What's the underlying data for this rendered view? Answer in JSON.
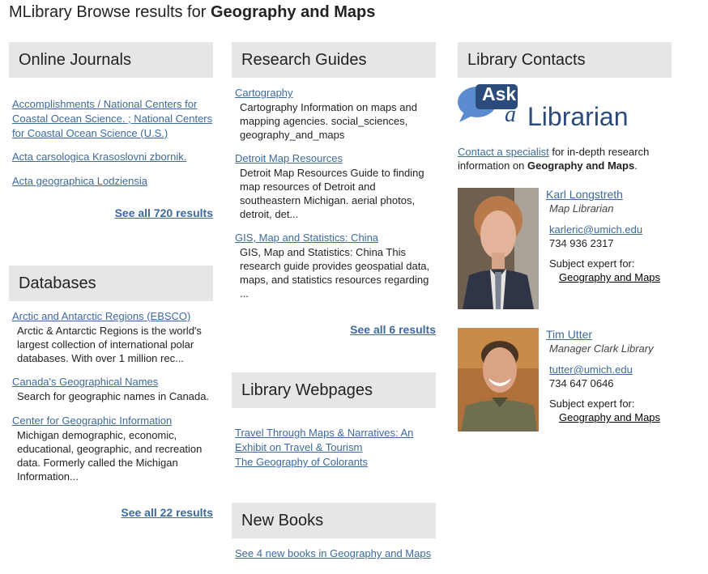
{
  "header": {
    "title_prefix": "MLibrary Browse results for",
    "title_subject": "Geography and Maps"
  },
  "journals": {
    "heading": "Online Journals",
    "items": [
      "Accomplishments / National Centers for Coastal Ocean Science. ; National Centers for Coastal Ocean Science (U.S.)",
      "Acta carsologica Krasoslovni zbornik.",
      "Acta geographica Lodziensia"
    ],
    "see_all": "See all 720 results"
  },
  "databases": {
    "heading": "Databases",
    "items": [
      {
        "title": "Arctic and Antarctic Regions (EBSCO)",
        "desc": "Arctic & Antarctic Regions is the world's largest collection of international polar databases. With over 1 million rec..."
      },
      {
        "title": "Canada's Geographical Names",
        "desc": "Search for geographic names in Canada."
      },
      {
        "title": "Center for Geographic Information",
        "desc": "Michigan demographic, economic, educational, geographic, and recreation data. Formerly called the Michigan Information..."
      }
    ],
    "see_all": "See all 22 results"
  },
  "guides": {
    "heading": "Research Guides",
    "items": [
      {
        "title": "Cartography",
        "desc": "Cartography Information on maps and mapping agencies. social_sciences, geography_and_maps"
      },
      {
        "title": "Detroit Map Resources",
        "desc": "Detroit Map Resources Guide to finding map resources of Detroit and southeastern Michigan. aerial photos, detroit, det..."
      },
      {
        "title": "GIS, Map and Statistics: China",
        "desc": "GIS, Map and Statistics: China This research guide provides geospatial data, maps, and statistics resources regarding ..."
      }
    ],
    "see_all": "See all 6 results"
  },
  "webpages": {
    "heading": "Library Webpages",
    "items": [
      "Travel Through Maps & Narratives: An Exhibit on Travel & Tourism",
      "The Geography of Colorants"
    ]
  },
  "books": {
    "heading": "New Books",
    "link": "See 4 new books in Geography and Maps"
  },
  "contacts": {
    "heading": "Library Contacts",
    "logo": {
      "ask": "Ask",
      "a": "a",
      "librarian": "Librarian"
    },
    "intro_link": "Contact a specialist",
    "intro_text": " for in-depth research information on ",
    "intro_subject": "Geography and Maps",
    "intro_end": ".",
    "people": [
      {
        "name": "Karl Longstreth",
        "role": "Map Librarian",
        "email": "karleric@umich.edu",
        "phone": "734 936 2317",
        "expert_label": "Subject expert for:",
        "expert_link": "Geography and Maps"
      },
      {
        "name": "Tim Utter",
        "role": "Manager Clark Library",
        "email": "tutter@umich.edu",
        "phone": "734 647 0646",
        "expert_label": "Subject expert for:",
        "expert_link": "Geography and Maps"
      }
    ]
  },
  "colors": {
    "link": "#3d6a9e",
    "header_bg": "#e6e6e6",
    "logo_blue": "#2a4b7c",
    "bubble": "#5b8ccf"
  }
}
